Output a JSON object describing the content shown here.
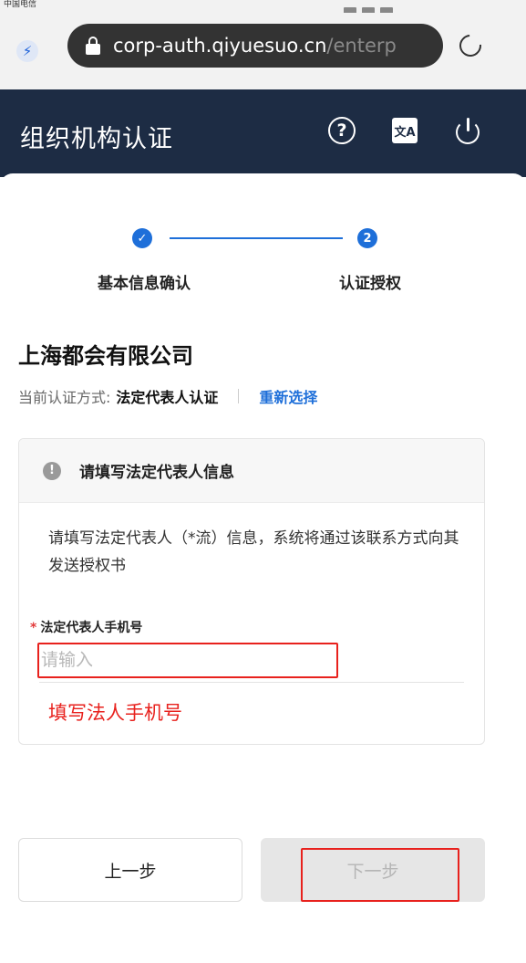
{
  "statusbar": {
    "carrier": "中国电信"
  },
  "browser": {
    "url_host": "corp-auth.qiyuesuo.cn",
    "url_path": "/enterp"
  },
  "header": {
    "title": "组织机构认证",
    "help_icon": "?",
    "translate_icon": "文A"
  },
  "steps": [
    {
      "label": "基本信息确认",
      "state": "done",
      "mark": "✓"
    },
    {
      "label": "认证授权",
      "state": "current",
      "mark": "2"
    }
  ],
  "company": {
    "name": "上海都会有限公司"
  },
  "auth_method": {
    "label": "当前认证方式:",
    "value": "法定代表人认证",
    "reselect": "重新选择"
  },
  "form": {
    "title": "请填写法定代表人信息",
    "info_icon": "!",
    "description": "请填写法定代表人（*流）信息，系统将通过该联系方式向其发送授权书",
    "required_mark": "*",
    "phone_label": "法定代表人手机号",
    "phone_value": "",
    "phone_placeholder": "请输入",
    "annotation": "填写法人手机号"
  },
  "buttons": {
    "prev": "上一步",
    "next": "下一步"
  },
  "colors": {
    "header_bg": "#1d2c44",
    "accent": "#1e6fd9",
    "annotation_red": "#e8211d"
  }
}
